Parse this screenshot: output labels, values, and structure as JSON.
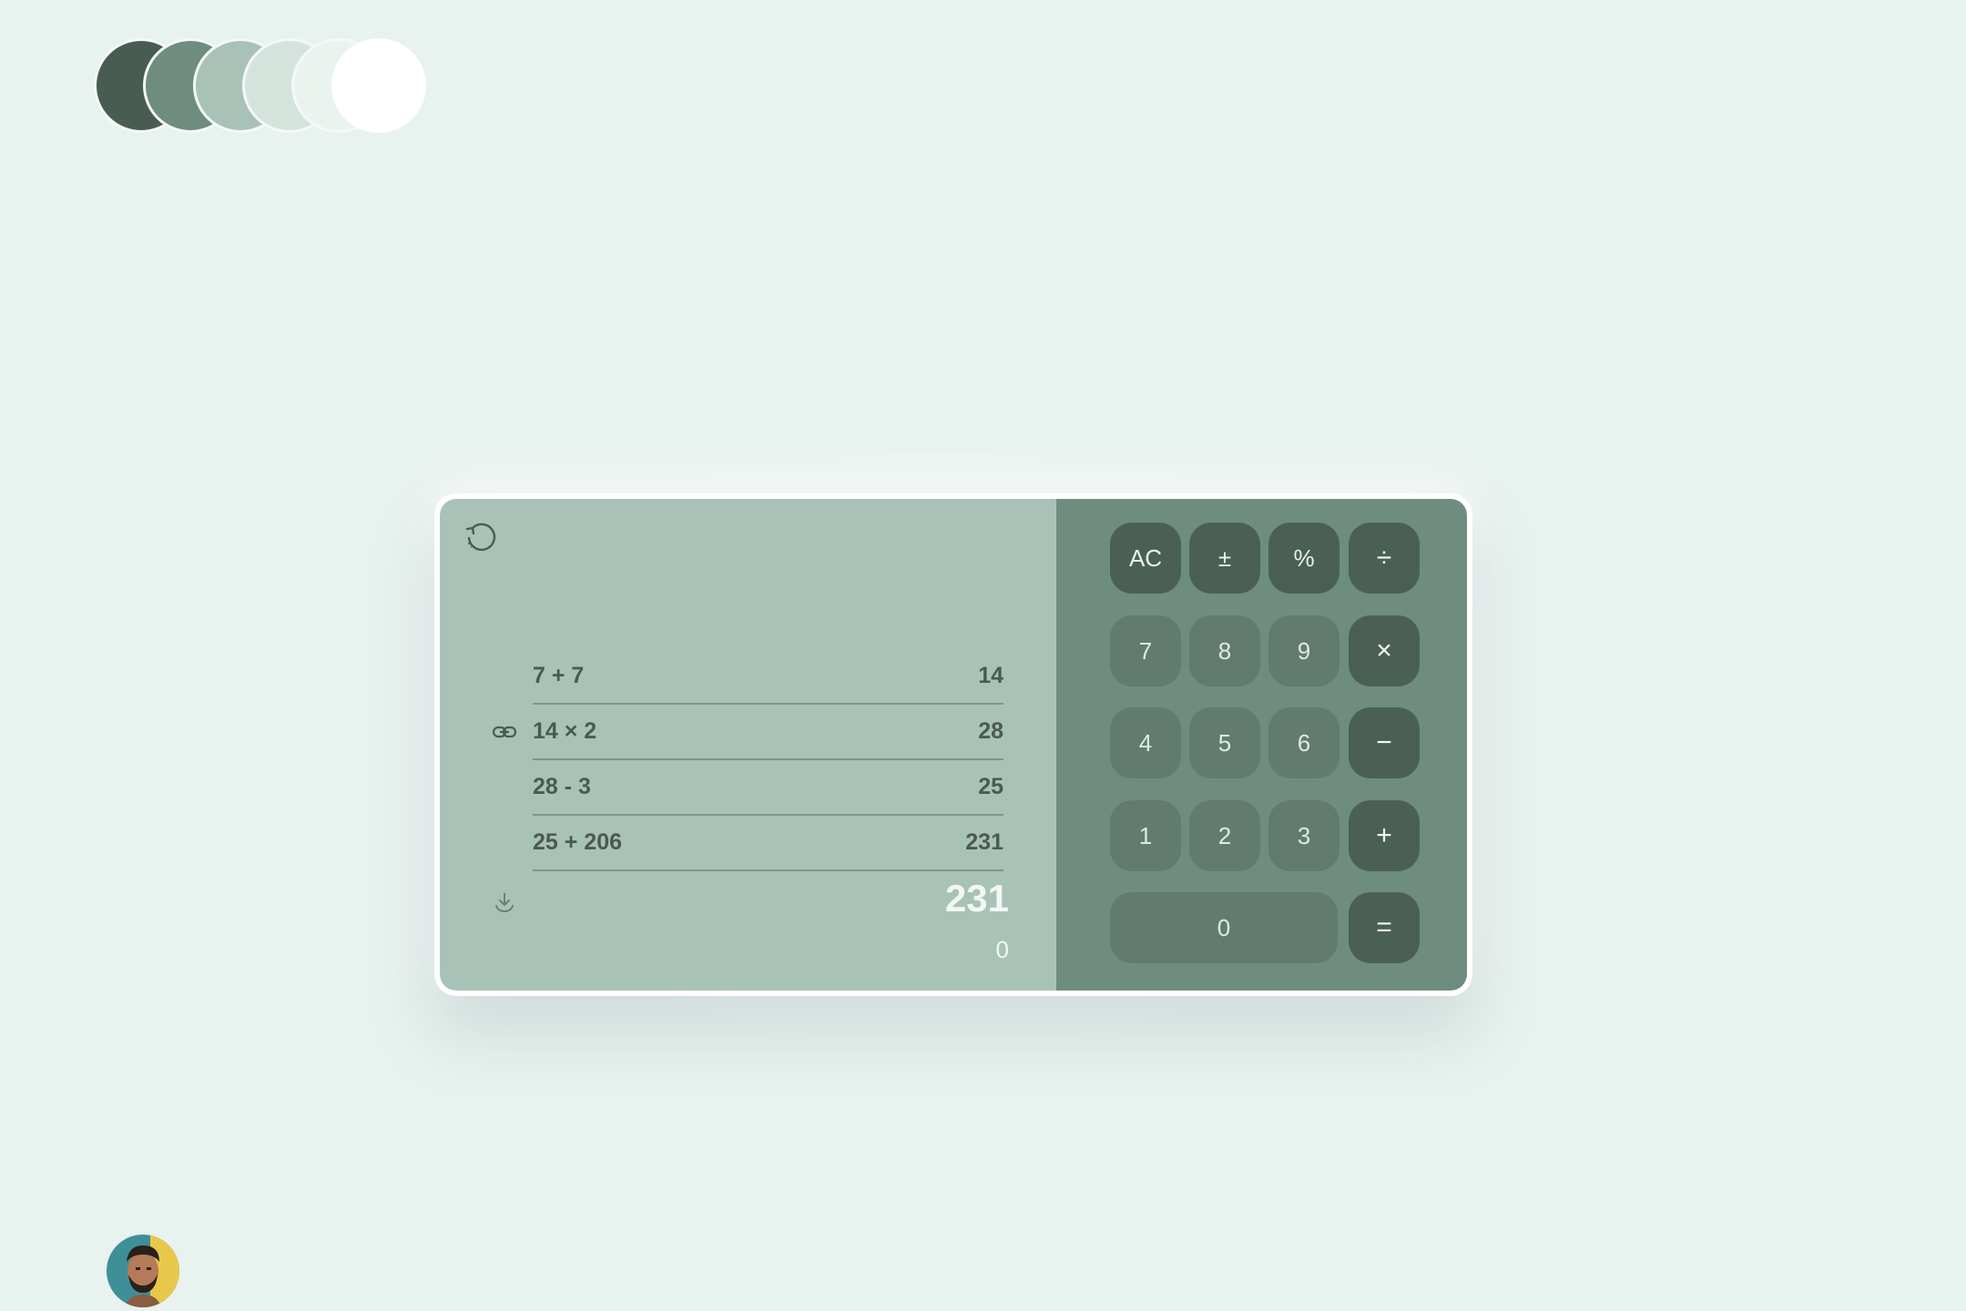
{
  "palette": {
    "swatches": [
      {
        "name": "swatch-darkest",
        "color": "#485c51"
      },
      {
        "name": "swatch-dark",
        "color": "#6f8d7f"
      },
      {
        "name": "swatch-mid",
        "color": "#a9c2b7"
      },
      {
        "name": "swatch-light",
        "color": "#d4e4dd"
      },
      {
        "name": "swatch-lighter",
        "color": "#ebf3ef"
      },
      {
        "name": "swatch-white",
        "color": "#ffffff"
      }
    ]
  },
  "display": {
    "history_icon": "history-icon",
    "link_icon": "link-icon",
    "save_icon": "download-icon",
    "history": [
      {
        "expression": "7 + 7",
        "result": "14"
      },
      {
        "expression": "14 × 2",
        "result": "28"
      },
      {
        "expression": "28 - 3",
        "result": "25"
      },
      {
        "expression": "25 + 206",
        "result": "231"
      }
    ],
    "result": "231",
    "current": "0"
  },
  "keypad": {
    "rows": [
      [
        {
          "label": "AC",
          "kind": "fn"
        },
        {
          "label": "±",
          "kind": "fn"
        },
        {
          "label": "%",
          "kind": "fn"
        },
        {
          "label": "÷",
          "kind": "op"
        }
      ],
      [
        {
          "label": "7",
          "kind": "num"
        },
        {
          "label": "8",
          "kind": "num"
        },
        {
          "label": "9",
          "kind": "num"
        },
        {
          "label": "×",
          "kind": "op"
        }
      ],
      [
        {
          "label": "4",
          "kind": "num"
        },
        {
          "label": "5",
          "kind": "num"
        },
        {
          "label": "6",
          "kind": "num"
        },
        {
          "label": "−",
          "kind": "op"
        }
      ],
      [
        {
          "label": "1",
          "kind": "num"
        },
        {
          "label": "2",
          "kind": "num"
        },
        {
          "label": "3",
          "kind": "num"
        },
        {
          "label": "+",
          "kind": "op"
        }
      ],
      [
        {
          "label": "0",
          "kind": "num"
        },
        {
          "label": "=",
          "kind": "op"
        }
      ]
    ]
  },
  "colors": {
    "background": "#e8f2ee",
    "display_panel": "#a9c2b7",
    "keypad_panel": "#6f8d7f",
    "function_key": "#4b6054",
    "number_key": "#617c6f"
  },
  "user": {
    "avatar_icon": "user-avatar"
  }
}
